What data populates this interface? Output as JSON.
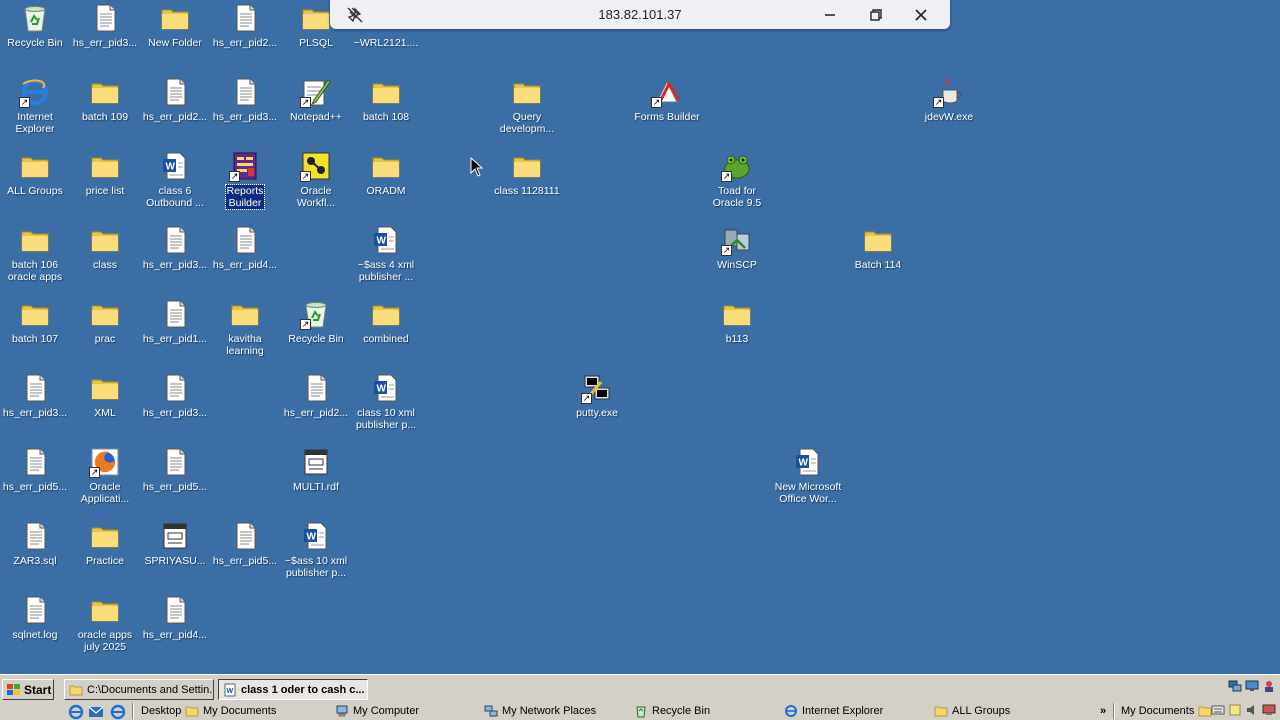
{
  "remote_bar": {
    "host": "183.82.101.37"
  },
  "desktop_icons": [
    {
      "label": "Recycle Bin",
      "icon": "recycle-bin-icon"
    },
    {
      "label": "hs_err_pid3...",
      "icon": "text-file-icon"
    },
    {
      "label": "New Folder",
      "icon": "folder-icon"
    },
    {
      "label": "hs_err_pid2...",
      "icon": "text-file-icon"
    },
    {
      "label": "PLSQL",
      "icon": "folder-icon"
    },
    {
      "label": "~WRL2121....",
      "icon": "folder-icon"
    },
    {
      "label": "Internet\nExplorer",
      "icon": "internet-explorer-icon"
    },
    {
      "label": "batch 109",
      "icon": "folder-icon"
    },
    {
      "label": "hs_err_pid2...",
      "icon": "text-file-icon"
    },
    {
      "label": "hs_err_pid3...",
      "icon": "text-file-icon"
    },
    {
      "label": "Notepad++",
      "icon": "notepad-plus-icon"
    },
    {
      "label": "batch 108",
      "icon": "folder-icon"
    },
    {
      "label": "Query\ndevelopm...",
      "icon": "folder-icon"
    },
    {
      "label": "Forms Builder",
      "icon": "forms-builder-icon"
    },
    {
      "label": "jdevW.exe",
      "icon": "jdev-exe-icon"
    },
    {
      "label": "ALL Groups",
      "icon": "folder-icon"
    },
    {
      "label": "price list",
      "icon": "folder-icon"
    },
    {
      "label": "class 6\nOutbound ...",
      "icon": "word-document-icon"
    },
    {
      "label": "Reports\nBuilder",
      "icon": "reports-builder-icon"
    },
    {
      "label": "Oracle\nWorkfl...",
      "icon": "oracle-workflow-icon"
    },
    {
      "label": "ORADM",
      "icon": "folder-icon"
    },
    {
      "label": "class 1128111",
      "icon": "folder-icon"
    },
    {
      "label": "Toad for\nOracle 9.5",
      "icon": "toad-icon"
    },
    {
      "label": "batch 106\noracle apps",
      "icon": "folder-icon"
    },
    {
      "label": "class",
      "icon": "folder-icon"
    },
    {
      "label": "hs_err_pid3...",
      "icon": "text-file-icon"
    },
    {
      "label": "hs_err_pid4...",
      "icon": "text-file-icon"
    },
    {
      "label": "~$ass 4 xml\npublisher ...",
      "icon": "word-document-icon"
    },
    {
      "label": "WinSCP",
      "icon": "winscp-icon"
    },
    {
      "label": "Batch 114",
      "icon": "folder-icon"
    },
    {
      "label": "batch 107",
      "icon": "folder-icon"
    },
    {
      "label": "prac",
      "icon": "folder-icon"
    },
    {
      "label": "hs_err_pid1...",
      "icon": "text-file-icon"
    },
    {
      "label": "kavitha\nlearning",
      "icon": "folder-icon"
    },
    {
      "label": "Recycle Bin",
      "icon": "recycle-bin-icon"
    },
    {
      "label": "combined",
      "icon": "folder-icon"
    },
    {
      "label": "b113",
      "icon": "folder-icon"
    },
    {
      "label": "hs_err_pid3...",
      "icon": "text-file-icon"
    },
    {
      "label": "XML",
      "icon": "folder-icon"
    },
    {
      "label": "hs_err_pid3...",
      "icon": "text-file-icon"
    },
    {
      "label": "hs_err_pid2...",
      "icon": "text-file-icon"
    },
    {
      "label": "class 10 xml\npublisher p...",
      "icon": "word-document-icon"
    },
    {
      "label": "putty.exe",
      "icon": "putty-icon"
    },
    {
      "label": "hs_err_pid5...",
      "icon": "text-file-icon"
    },
    {
      "label": "Oracle\nApplicati...",
      "icon": "firefox-icon"
    },
    {
      "label": "hs_err_pid5...",
      "icon": "text-file-icon"
    },
    {
      "label": "MULTI.rdf",
      "icon": "rdf-file-icon"
    },
    {
      "label": "New Microsoft\nOffice Wor...",
      "icon": "word-document-icon"
    },
    {
      "label": "ZAR3.sql",
      "icon": "text-file-icon"
    },
    {
      "label": "Practice",
      "icon": "folder-icon"
    },
    {
      "label": "SPRIYASU...",
      "icon": "rdf-file-icon"
    },
    {
      "label": "hs_err_pid5...",
      "icon": "text-file-icon"
    },
    {
      "label": "~$ass 10 xml\npublisher p...",
      "icon": "word-document-icon"
    },
    {
      "label": "sqlnet.log",
      "icon": "text-file-icon"
    },
    {
      "label": "oracle apps\njuly 2025",
      "icon": "folder-icon"
    },
    {
      "label": "hs_err_pid4...",
      "icon": "text-file-icon"
    }
  ],
  "taskbar": {
    "start_label": "Start",
    "tasks": [
      {
        "label": "C:\\Documents and Settin...",
        "icon": "folder-icon",
        "active": false
      },
      {
        "label": "class 1 oder to cash c...",
        "icon": "word-document-icon",
        "active": true
      }
    ],
    "bar_items": [
      {
        "label": "Desktop",
        "icon": ""
      },
      {
        "label": "My Documents",
        "icon": "folder-icon"
      },
      {
        "label": "My Computer",
        "icon": "computer-icon"
      },
      {
        "label": "My Network Places",
        "icon": "network-icon"
      },
      {
        "label": "Recycle Bin",
        "icon": "recycle-bin-icon"
      },
      {
        "label": "Internet Explorer",
        "icon": "internet-explorer-icon"
      },
      {
        "label": "ALL Groups",
        "icon": "folder-icon"
      },
      {
        "label": "My Documents",
        "icon": "folder-icon"
      }
    ],
    "overflow": "»"
  },
  "colors": {
    "desktop": "#3a6ea5",
    "folder": "#f5d76e",
    "taskbar": "#d4d0c8"
  }
}
